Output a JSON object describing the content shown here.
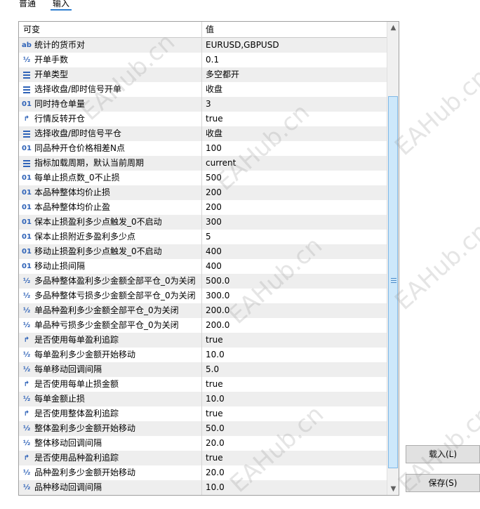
{
  "tabs": [
    "普通",
    "输入"
  ],
  "header": {
    "name": "可变",
    "value": "值"
  },
  "rows": [
    {
      "icon": "ab",
      "name": "统计的货币对",
      "value": "EURUSD,GBPUSD"
    },
    {
      "icon": "half",
      "name": "开单手数",
      "value": "0.1"
    },
    {
      "icon": "list",
      "name": "开单类型",
      "value": "多空都开"
    },
    {
      "icon": "list",
      "name": "选择收盘/即时信号开单",
      "value": "收盘"
    },
    {
      "icon": "01",
      "name": "同时持仓单量",
      "value": "3"
    },
    {
      "icon": "arrow",
      "name": "行情反转开仓",
      "value": "true"
    },
    {
      "icon": "list",
      "name": "选择收盘/即时信号平仓",
      "value": "收盘"
    },
    {
      "icon": "01",
      "name": "同品种开仓价格相差N点",
      "value": "100"
    },
    {
      "icon": "list",
      "name": "指标加载周期，默认当前周期",
      "value": "current"
    },
    {
      "icon": "01",
      "name": "每单止损点数_0不止损",
      "value": "500"
    },
    {
      "icon": "01",
      "name": "本品种整体均价止损",
      "value": "200"
    },
    {
      "icon": "01",
      "name": "本品种整体均价止盈",
      "value": "200"
    },
    {
      "icon": "01",
      "name": "保本止损盈利多少点触发_0不启动",
      "value": "300"
    },
    {
      "icon": "01",
      "name": "保本止损附近多盈利多少点",
      "value": "5"
    },
    {
      "icon": "01",
      "name": "移动止损盈利多少点触发_0不启动",
      "value": "400"
    },
    {
      "icon": "01",
      "name": "移动止损间隔",
      "value": "400"
    },
    {
      "icon": "half",
      "name": "多品种整体盈利多少金额全部平仓_0为关闭",
      "value": "500.0"
    },
    {
      "icon": "half",
      "name": "多品种整体亏损多少金额全部平仓_0为关闭",
      "value": "300.0"
    },
    {
      "icon": "half",
      "name": "单品种盈利多少金额全部平仓_0为关闭",
      "value": "200.0"
    },
    {
      "icon": "half",
      "name": "单品种亏损多少金额全部平仓_0为关闭",
      "value": "200.0"
    },
    {
      "icon": "arrow",
      "name": "是否使用每单盈利追踪",
      "value": "true"
    },
    {
      "icon": "half",
      "name": "每单盈利多少金额开始移动",
      "value": "10.0"
    },
    {
      "icon": "half",
      "name": "每单移动回调间隔",
      "value": "5.0"
    },
    {
      "icon": "arrow",
      "name": "是否使用每单止损金额",
      "value": "true"
    },
    {
      "icon": "half",
      "name": "每单金额止损",
      "value": "10.0"
    },
    {
      "icon": "arrow",
      "name": "是否使用整体盈利追踪",
      "value": "true"
    },
    {
      "icon": "half",
      "name": "整体盈利多少金额开始移动",
      "value": "50.0"
    },
    {
      "icon": "half",
      "name": "整体移动回调间隔",
      "value": "20.0"
    },
    {
      "icon": "arrow",
      "name": "是否使用品种盈利追踪",
      "value": "true"
    },
    {
      "icon": "half",
      "name": "品种盈利多少金额开始移动",
      "value": "20.0"
    },
    {
      "icon": "half",
      "name": "品种移动回调间隔",
      "value": "10.0"
    }
  ],
  "buttons": {
    "load": "载入(L)",
    "save": "保存(S)"
  },
  "watermark": "EAHub.cn",
  "colors": {
    "accent": "#2f7fd0",
    "row_alt": "#eeeeee"
  }
}
